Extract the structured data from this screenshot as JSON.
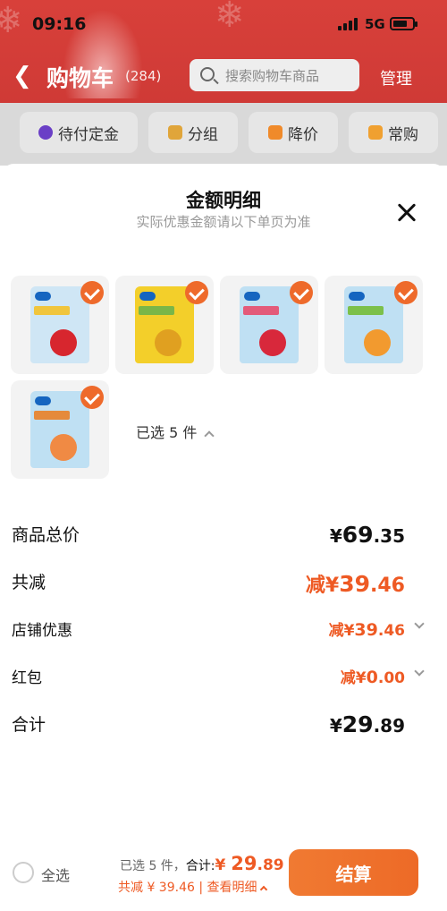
{
  "status_bar": {
    "time": "09:16",
    "network": "5G"
  },
  "header": {
    "back_icon": "back-arrow-icon",
    "title": "购物车",
    "count": "(284)",
    "search_placeholder": "搜索购物车商品",
    "manage_label": "管理"
  },
  "filters": [
    {
      "label": "待付定金",
      "icon": "clock-icon"
    },
    {
      "label": "分组",
      "icon": "folder-icon"
    },
    {
      "label": "降价",
      "icon": "price-drop-icon"
    },
    {
      "label": "常购",
      "icon": "cart-icon"
    }
  ],
  "sheet": {
    "title": "金额明细",
    "subtitle": "实际优惠金额请以下单页为准",
    "selected_text": "已选 5 件",
    "products": [
      {
        "name": "apple-chips",
        "selected": true,
        "color": "#cfe6f5",
        "band": "#f0c53d",
        "fruit": "#d7262e"
      },
      {
        "name": "banana-chips",
        "selected": true,
        "color": "#f3cf2a",
        "band": "#7ab648",
        "fruit": "#e0a020"
      },
      {
        "name": "strawberry-chips",
        "selected": true,
        "color": "#bfe0f3",
        "band": "#e35b7a",
        "fruit": "#d8283b"
      },
      {
        "name": "peach-chips",
        "selected": true,
        "color": "#bfe0f3",
        "band": "#7cc04a",
        "fruit": "#f29a2f"
      },
      {
        "name": "apricot-chips",
        "selected": true,
        "color": "#bfe0f3",
        "band": "#e58a3b",
        "fruit": "#f08a44"
      }
    ],
    "rows": {
      "subtotal": {
        "label": "商品总价",
        "currency": "¥",
        "int": "69",
        "dec": ".35"
      },
      "total_discount": {
        "label": "共减",
        "prefix": "减",
        "currency": "¥",
        "int": "39",
        "dec": ".46"
      },
      "store_discount": {
        "label": "店铺优惠",
        "prefix": "减",
        "currency": "¥",
        "int": "39",
        "dec": ".46"
      },
      "red_packet": {
        "label": "红包",
        "prefix": "减",
        "currency": "¥",
        "int": "0",
        "dec": ".00"
      },
      "total": {
        "label": "合计",
        "currency": "¥",
        "int": "29",
        "dec": ".89"
      }
    }
  },
  "checkout_bar": {
    "select_all": "全选",
    "selected_count": "已选 5 件，",
    "total_label": "合计:",
    "total_currency": "¥ ",
    "total_int": "29",
    "total_dec": ".89",
    "discount_text": "共减 ¥ 39.46 | 查看明细",
    "checkout_label": "结算"
  },
  "colors": {
    "accent": "#ee5a24",
    "header_red": "#d8403a"
  }
}
